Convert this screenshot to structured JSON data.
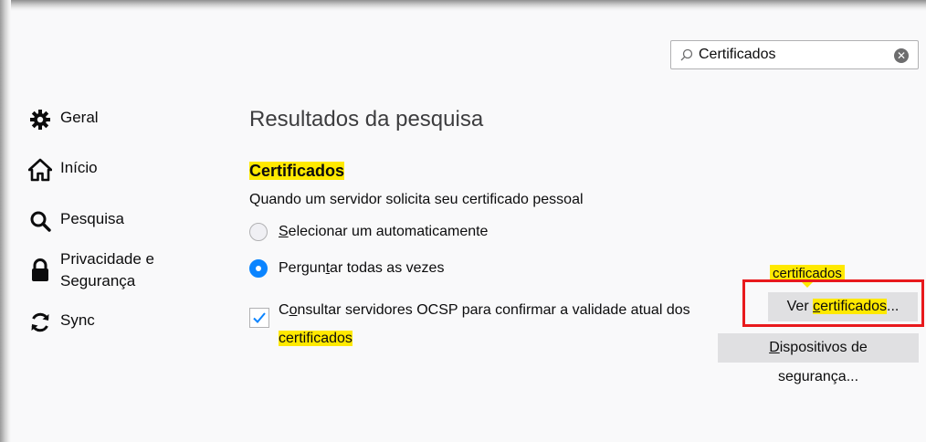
{
  "search": {
    "value": "Certificados",
    "placeholder": ""
  },
  "sidebar": {
    "items": [
      {
        "label": "Geral",
        "icon": "gear-icon"
      },
      {
        "label": "Início",
        "icon": "home-icon"
      },
      {
        "label": "Pesquisa",
        "icon": "search-icon"
      },
      {
        "label_line1": "Privacidade e",
        "label_line2": "Segurança",
        "icon": "lock-icon"
      },
      {
        "label": "Sync",
        "icon": "sync-icon"
      }
    ]
  },
  "main": {
    "heading": "Resultados da pesquisa",
    "section_title": "Certificados",
    "description": "Quando um servidor solicita seu certificado pessoal",
    "radio_auto": {
      "pre": "",
      "ul": "S",
      "post": "elecionar um automaticamente",
      "selected": false
    },
    "radio_ask": {
      "pre": "Pergun",
      "ul": "t",
      "post": "ar todas as vezes",
      "selected": true
    },
    "ocsp": {
      "pre": "C",
      "ul": "o",
      "post": "nsultar servidores OCSP para confirmar a validade atual dos",
      "line2": "certificados",
      "checked": true
    },
    "tooltip": "certificados",
    "view_button": {
      "pre": "Ver ",
      "ul": "c",
      "post": "ertificados",
      "ellipsis": "..."
    },
    "devices_button": {
      "ul": "D",
      "post": "ispositivos de segurança..."
    }
  },
  "colors": {
    "highlight": "#ffe900",
    "accent": "#0a84ff",
    "annotation": "#e8191c"
  }
}
